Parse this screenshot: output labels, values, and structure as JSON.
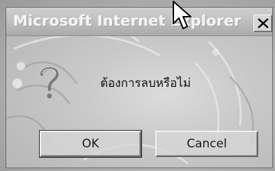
{
  "dialog": {
    "title": "Microsoft Internet Explorer",
    "close_icon": "close-icon",
    "message": "ต้องการลบหรือไม่",
    "icon": "question-icon",
    "buttons": {
      "ok_label": "OK",
      "cancel_label": "Cancel"
    }
  },
  "colors": {
    "title_text": "#f4f4f4",
    "button_face": "#d7d7d7",
    "background": "#a9a9a9"
  },
  "cursor": "mouse-pointer-icon"
}
